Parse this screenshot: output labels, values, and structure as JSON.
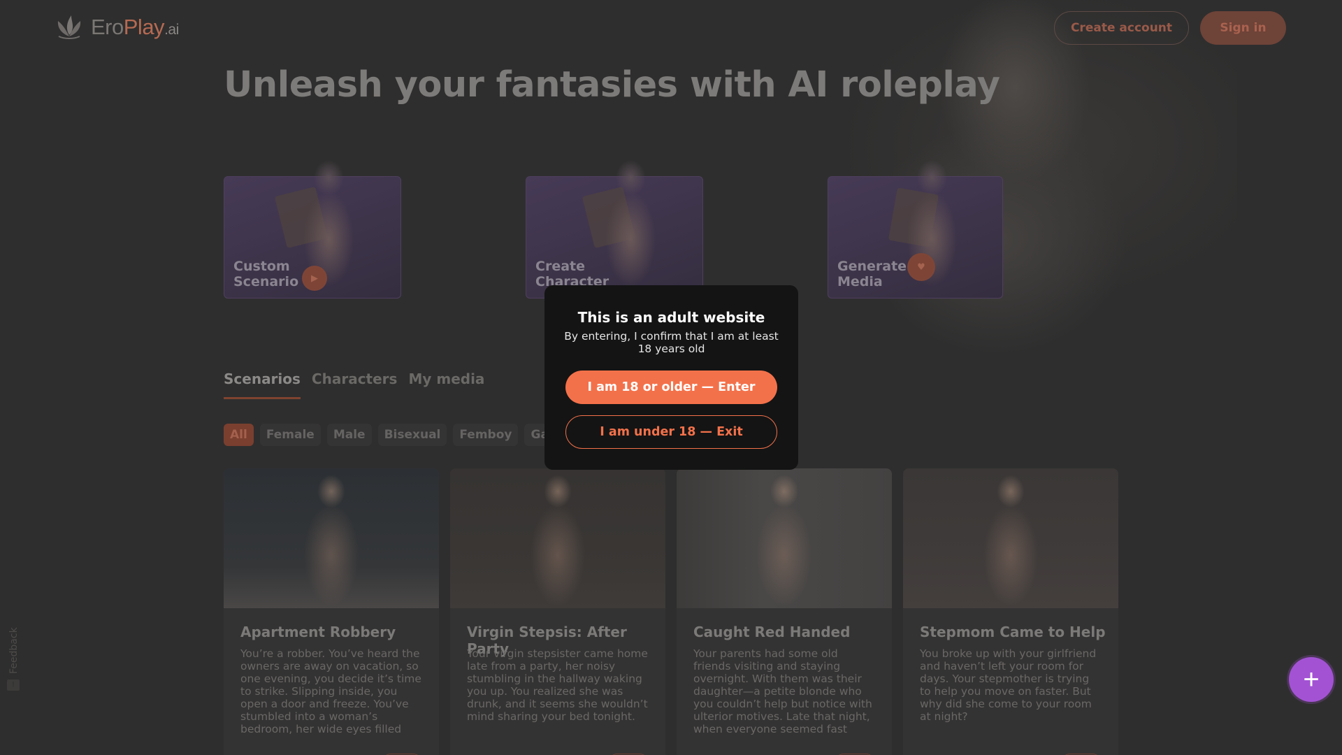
{
  "header": {
    "logo": {
      "name_part1": "Ero",
      "name_part2": "Play",
      "name_suffix": ".ai",
      "icon": "flame-leaf-logo-icon"
    },
    "create_account": "Create account",
    "sign_in": "Sign in"
  },
  "hero": {
    "title": "Unleash your fantasies with AI roleplay"
  },
  "features": [
    {
      "label": "Custom Scenario",
      "icon": "play-icon"
    },
    {
      "label": "Create Character",
      "icon": "play-icon"
    },
    {
      "label": "Generate Media",
      "icon": "heart-icon"
    }
  ],
  "tabs": [
    "Scenarios",
    "Characters",
    "My media"
  ],
  "active_tab": "Scenarios",
  "filters": [
    "All",
    "Female",
    "Male",
    "Bisexual",
    "Femboy",
    "Gay"
  ],
  "active_filter": "All",
  "scenarios": [
    {
      "title": "Apartment Robbery",
      "description": "You’re a robber. You’ve heard the owners are away on vacation, so one evening, you decide it’s time to strike. Slipping inside, you open a door and freeze. You’ve stumbled into a woman’s bedroom, her wide eyes filled with terror. One thoug..."
    },
    {
      "title": "Virgin Stepsis: After Party",
      "description": "Your virgin stepsister came home late from a party, her noisy stumbling in the hallway waking you up. You realized she was drunk, and it seems she wouldn’t mind sharing your bed tonight."
    },
    {
      "title": "Caught Red Handed",
      "description": "Your parents had some old friends visiting and staying overnight. With them was their daughter—a petite blonde who you couldn’t help but notice with ulterior motives. Late that night, when everyone seemed fast asleep, you decided to relieve..."
    },
    {
      "title": "Stepmom Came to Help",
      "description": "You broke up with your girlfriend and haven’t left your room for days. Your stepmother is trying to help you move on faster. But why did she come to your room at night?"
    }
  ],
  "feedback": {
    "label": "Feedback"
  },
  "fab": {
    "label": "+"
  },
  "modal": {
    "title": "This is an adult website",
    "text": "By entering, I confirm that I am at least 18 years old",
    "enter_label": "I am 18 or older — Enter",
    "exit_label": "I am under 18 — Exit"
  },
  "colors": {
    "accent": "#f3714a",
    "fab": "#a352d4",
    "modal_bg": "#141414",
    "page_bg": "#2e2e2e"
  }
}
